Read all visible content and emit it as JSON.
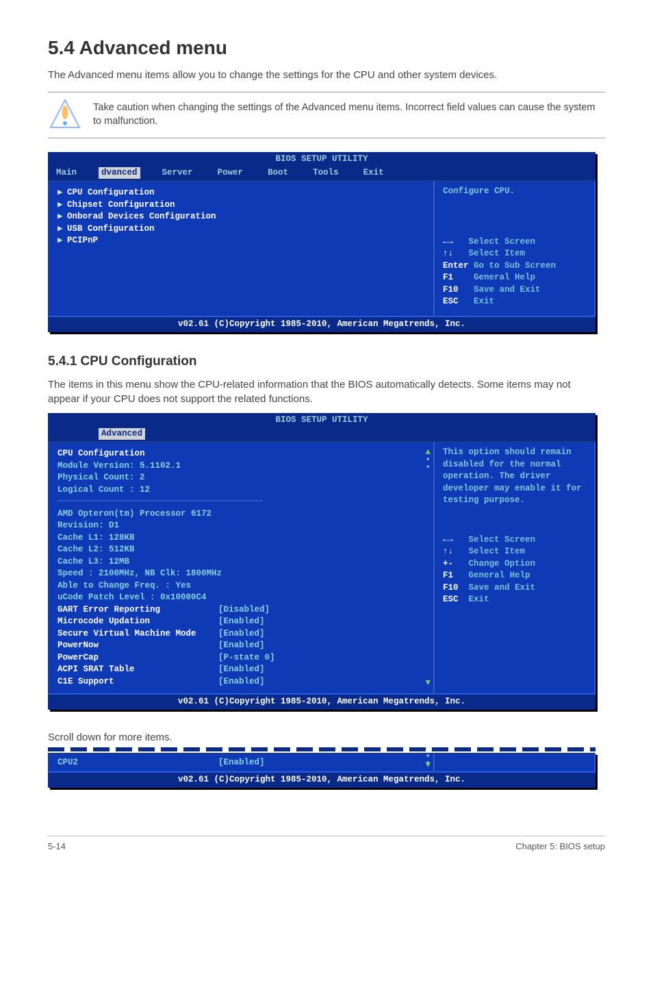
{
  "heading": "5.4      Advanced menu",
  "intro": "The Advanced menu items allow you to change the settings for the CPU and other system devices.",
  "note": "Take caution when changing the settings of the Advanced menu items. Incorrect field values can cause the system to malfunction.",
  "bios1": {
    "title": "BIOS SETUP UTILITY",
    "menus": [
      "Main",
      "dvanced",
      "Server",
      "Power",
      "Boot",
      "Tools",
      "Exit"
    ],
    "selectedMenu": "dvanced",
    "items": [
      "CPU Configuration",
      "Chipset Configuration",
      "Onborad Devices Configuration",
      "USB Configuration",
      "PCIPnP"
    ],
    "help": "Configure CPU.",
    "nav": [
      {
        "k": "←→",
        "v": "Select Screen"
      },
      {
        "k": "↑↓",
        "v": "Select Item"
      },
      {
        "k": "Enter",
        "v": "Go to Sub Screen"
      },
      {
        "k": "F1",
        "v": "General Help"
      },
      {
        "k": "F10",
        "v": "Save and Exit"
      },
      {
        "k": "ESC",
        "v": "Exit"
      }
    ],
    "footer": "v02.61 (C)Copyright 1985-2010, American Megatrends, Inc."
  },
  "subheading": "5.4.1        CPU Configuration",
  "subpara": "The items in this menu show the CPU-related information that the BIOS automatically detects. Some items may not appear if your CPU does not support the related functions.",
  "bios2": {
    "title": "BIOS SETUP UTILITY",
    "tab": "Advanced",
    "header": "CPU Configuration",
    "info": [
      "Module Version: 5.1102.1",
      "Physical Count: 2",
      "Logical Count : 12"
    ],
    "info2": [
      "AMD Opteron(tm) Processor 6172",
      "Revision: D1",
      "Cache L1: 128KB",
      "Cache L2: 512KB",
      "Cache L3: 12MB",
      "Speed   : 2100MHz,    NB Clk: 1800MHz",
      "Able to Change Freq.   : Yes",
      "uCode Patch Level      : 0x10000C4"
    ],
    "opts": [
      {
        "k": "GART Error Reporting",
        "v": "[Disabled]"
      },
      {
        "k": "Microcode Updation",
        "v": "[Enabled]"
      },
      {
        "k": "Secure Virtual Machine Mode",
        "v": "[Enabled]"
      },
      {
        "k": "PowerNow",
        "v": "[Enabled]"
      },
      {
        "k": "PowerCap",
        "v": "[P-state 0]"
      },
      {
        "k": "ACPI SRAT Table",
        "v": "[Enabled]"
      },
      {
        "k": "C1E Support",
        "v": "[Enabled]"
      }
    ],
    "help1": "This option should remain disabled for the normal operation. The driver developer may enable it for testing purpose.",
    "nav": [
      {
        "k": "←→",
        "v": "Select Screen"
      },
      {
        "k": "↑↓",
        "v": "Select Item"
      },
      {
        "k": "+-",
        "v": "Change Option"
      },
      {
        "k": "F1",
        "v": "General Help"
      },
      {
        "k": "F10",
        "v": "Save and Exit"
      },
      {
        "k": "ESC",
        "v": "Exit"
      }
    ],
    "footer": "v02.61 (C)Copyright 1985-2010, American Megatrends, Inc."
  },
  "scrollText": "Scroll down for more items.",
  "bios3": {
    "k": "CPU2",
    "v": "[Enabled]",
    "footer": "v02.61 (C)Copyright 1985-2010, American Megatrends, Inc."
  },
  "pageFooter": {
    "left": "5-14",
    "right": "Chapter 5: BIOS setup"
  }
}
